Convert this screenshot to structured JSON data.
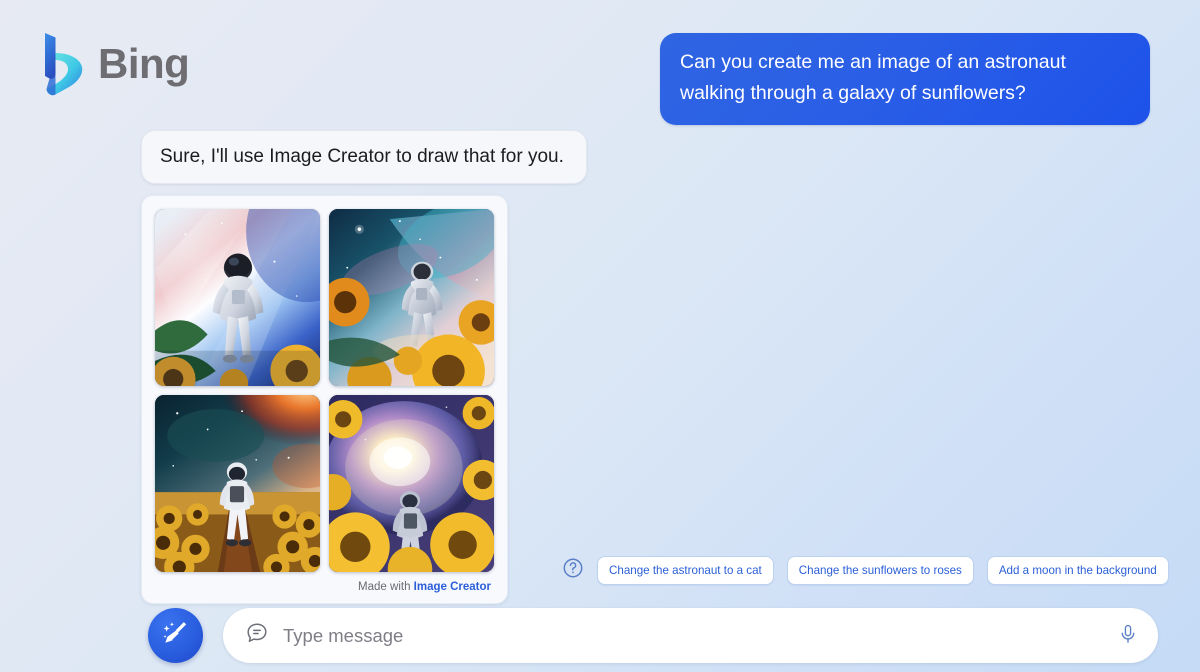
{
  "brand": {
    "name": "Bing",
    "logo_icon": "bing-b-logo-icon"
  },
  "conversation": {
    "user_message": "Can you create me an image of an astronaut walking through a galaxy of sunflowers?",
    "bot_message": "Sure, I'll use Image Creator to draw that for you."
  },
  "image_card": {
    "attribution_prefix": "Made with ",
    "attribution_link": "Image Creator",
    "images": [
      {
        "alt": "Astronaut walking toward bright nebula with sunflowers and leaves in foreground"
      },
      {
        "alt": "Astronaut walking through teal and pink galaxy above a field of sunflowers"
      },
      {
        "alt": "Astronaut walking down a path through a dark sunflower field under a fiery nebula"
      },
      {
        "alt": "Astronaut walking into a glowing spiral galaxy portal framed by sunflowers"
      }
    ]
  },
  "suggestions": {
    "help_icon": "question-mark-circle-icon",
    "chips": [
      "Change the astronaut to a cat",
      "Change the sunflowers to roses",
      "Add a moon in the background"
    ]
  },
  "composer": {
    "new_topic_icon": "broom-sparkle-icon",
    "message_icon": "chat-bubble-icon",
    "placeholder": "Type message",
    "value": "",
    "mic_icon": "microphone-icon"
  },
  "colors": {
    "accent_blue": "#2a5fd8",
    "user_bubble_blue": "#2a5ee6",
    "brand_grey": "#6d6d72",
    "page_bg_start": "#e7eaf3",
    "page_bg_end": "#c5dbf6"
  }
}
